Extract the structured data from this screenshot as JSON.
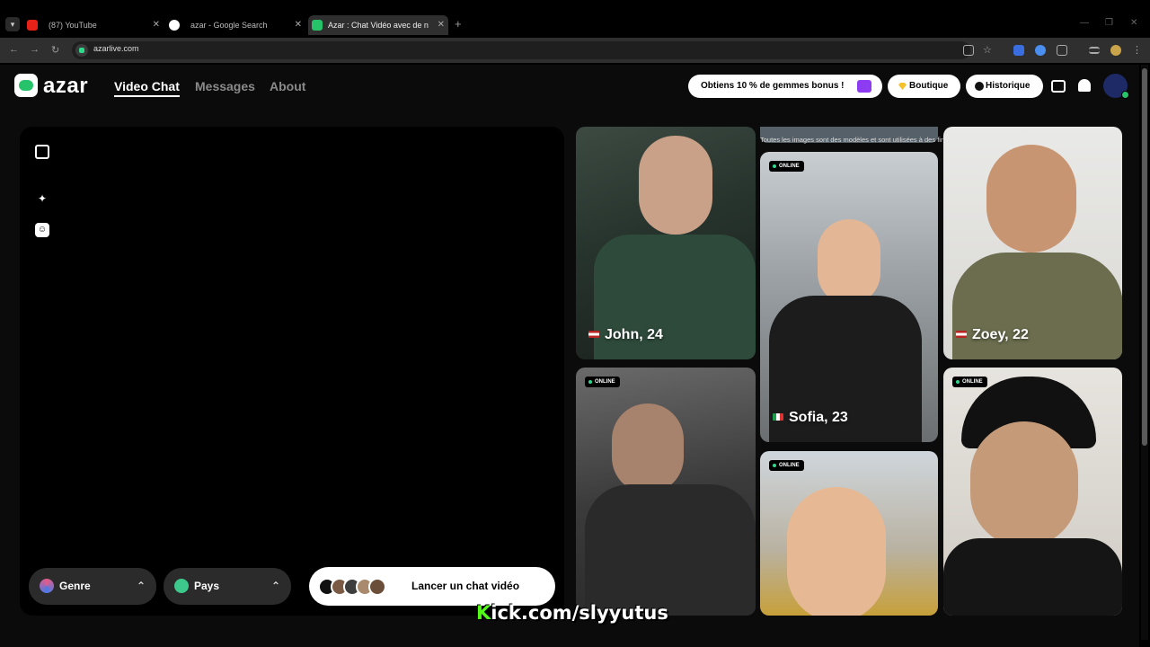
{
  "browser": {
    "tabs": [
      {
        "title": "(87) YouTube",
        "favicon": "youtube-icon"
      },
      {
        "title": "azar - Google Search",
        "favicon": "google-icon"
      },
      {
        "title": "Azar : Chat Vidéo avec de n",
        "favicon": "azar-icon",
        "active": true
      }
    ],
    "url": "azarlive.com"
  },
  "header": {
    "logo_text": "azar",
    "nav": [
      "Video Chat",
      "Messages",
      "About"
    ],
    "promo": "Obtiens 10 % de gemmes bonus !",
    "shop": "Boutique",
    "history": "Historique"
  },
  "video_panel": {
    "genre": "Genre",
    "pays": "Pays",
    "start": "Lancer un chat vidéo"
  },
  "gallery": {
    "disclaimer": "Toutes les images sont des modèles et sont utilisées à des fins d'illustration uniquement",
    "online_label": "ONLINE",
    "profiles": [
      {
        "name": "John, 24",
        "flag": "US"
      },
      {
        "name": "Sofia, 23",
        "flag": "IT"
      },
      {
        "name": "Zoey, 22",
        "flag": "US"
      }
    ]
  },
  "overlay": {
    "kick_k": "K",
    "kick_rest": "ick.com/slyyutus"
  },
  "colors": {
    "accent_green": "#26c36b",
    "online_green": "#2fd88a",
    "kick_green": "#53fc18"
  }
}
